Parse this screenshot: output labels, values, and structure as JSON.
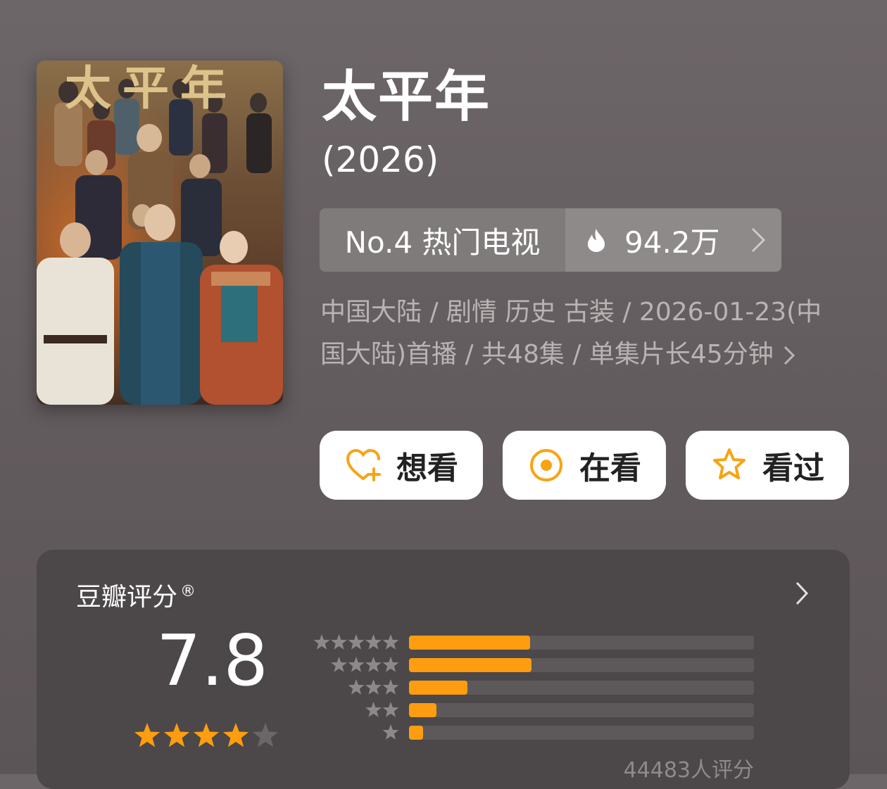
{
  "movie": {
    "title": "太平年",
    "year": "(2026)",
    "poster_title_text": "太平年"
  },
  "rank": {
    "label": "No.4 热门电视",
    "heat": "94.2万"
  },
  "meta": {
    "line": "中国大陆 / 剧情 历史 古装 / 2026-01-23(中国大陆)首播 / 共48集 / 单集片长45分钟"
  },
  "actions": {
    "want_label": "想看",
    "watching_label": "在看",
    "watched_label": "看过"
  },
  "rating": {
    "title": "豆瓣评分",
    "registered_mark": "®",
    "score": "7.8",
    "stars": 4,
    "count_text": "44483人评分",
    "distribution": [
      {
        "stars": 5,
        "fraction": 0.35
      },
      {
        "stars": 4,
        "fraction": 0.355
      },
      {
        "stars": 3,
        "fraction": 0.17
      },
      {
        "stars": 2,
        "fraction": 0.08
      },
      {
        "stars": 1,
        "fraction": 0.04
      }
    ]
  },
  "colors": {
    "accent": "#ff9d10",
    "background": "#655e60",
    "card": "#4c4748"
  }
}
